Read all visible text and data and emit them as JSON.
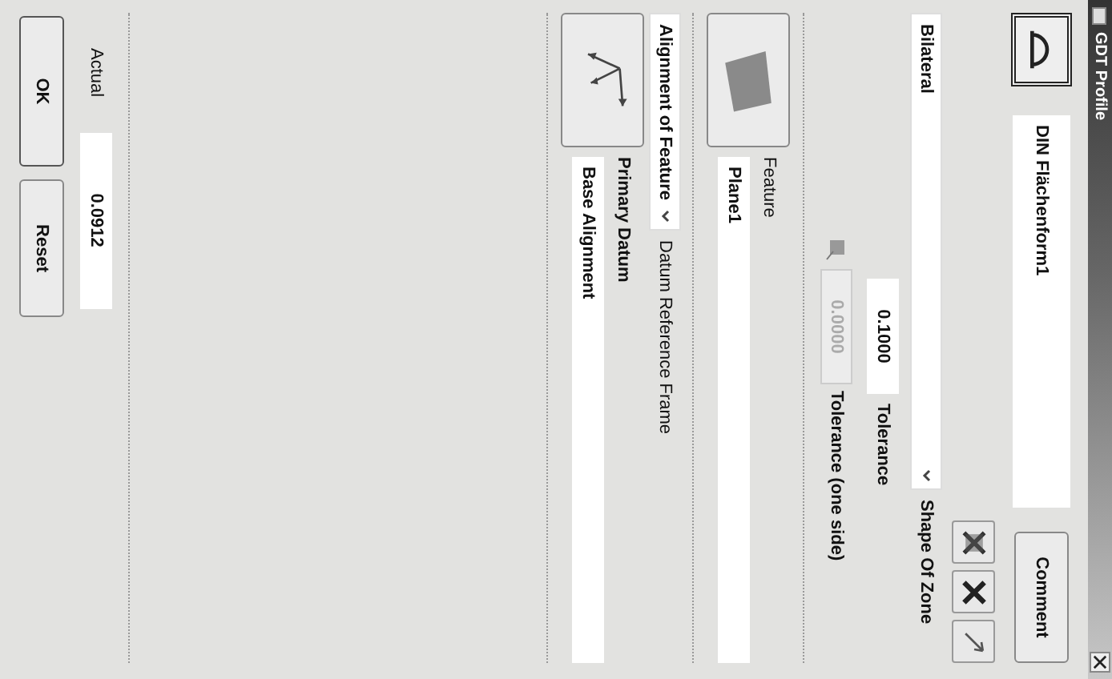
{
  "window": {
    "title": "GDT Profile"
  },
  "name": {
    "value": "DIN Flächenform1"
  },
  "comment_button": "Comment",
  "shape_of_zone": {
    "value": "Bilateral",
    "label": "Shape Of Zone"
  },
  "tolerance": {
    "value": "0.1000",
    "label": "Tolerance"
  },
  "tolerance_one_side": {
    "value": "0.0000",
    "label": "Tolerance (one side)",
    "disabled": true
  },
  "feature": {
    "label": "Feature",
    "value": "Plane1"
  },
  "datum_reference_frame": {
    "value": "Alignment of Feature",
    "label": "Datum Reference Frame"
  },
  "primary_datum": {
    "label": "Primary Datum",
    "value": "Base Alignment"
  },
  "actual": {
    "label": "Actual",
    "value": "0.0912"
  },
  "buttons": [
    "OK",
    "Reset"
  ]
}
